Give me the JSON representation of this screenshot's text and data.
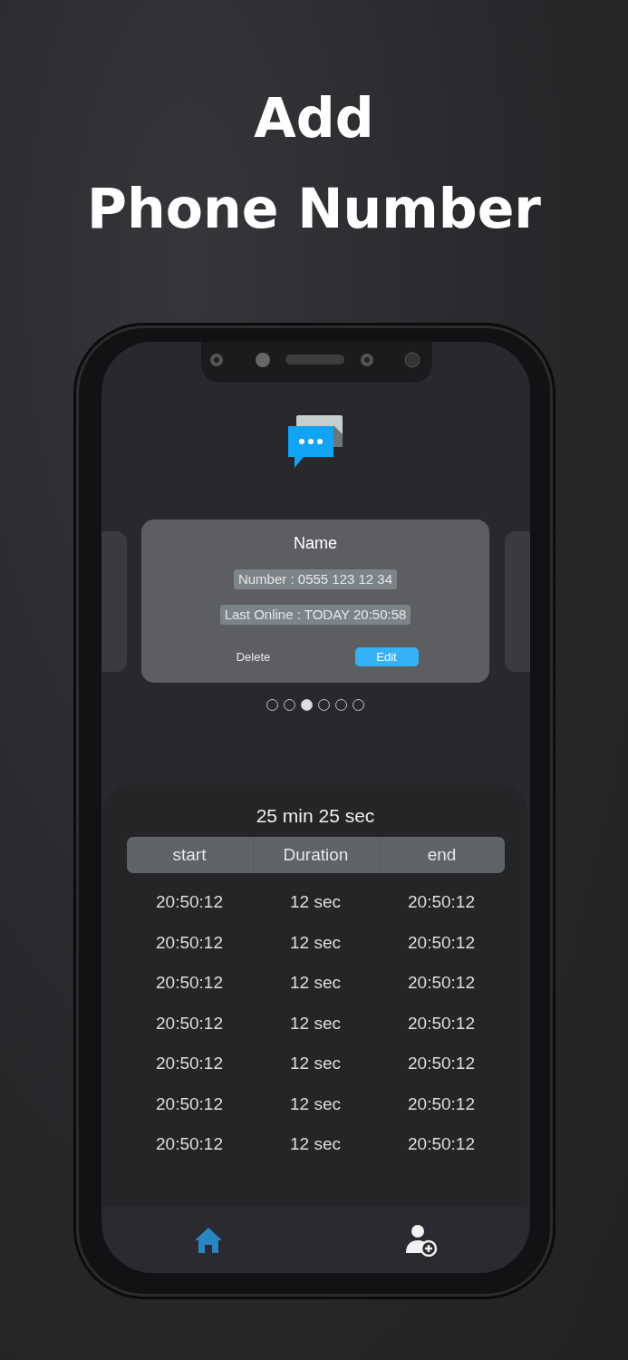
{
  "headline": [
    "Add",
    "Phone Number"
  ],
  "contact_card": {
    "name": "Name",
    "number": "Number : 0555 123 12 34",
    "last_online": "Last Online : TODAY 20:50:58",
    "buttons": [
      {
        "label": "Delete",
        "kind": "plain"
      },
      {
        "label": "Edit",
        "kind": "primary"
      }
    ]
  },
  "pager": [
    {
      "selected": false
    },
    {
      "selected": false
    },
    {
      "selected": true
    },
    {
      "selected": false
    },
    {
      "selected": false
    },
    {
      "selected": false
    }
  ],
  "calls": {
    "total": "25 min 25 sec",
    "columns": [
      "start",
      "Duration",
      "end"
    ],
    "rows": [
      [
        "20:50:12",
        "12 sec",
        "20:50:12"
      ],
      [
        "20:50:12",
        "12 sec",
        "20:50:12"
      ],
      [
        "20:50:12",
        "12 sec",
        "20:50:12"
      ],
      [
        "20:50:12",
        "12 sec",
        "20:50:12"
      ],
      [
        "20:50:12",
        "12 sec",
        "20:50:12"
      ],
      [
        "20:50:12",
        "12 sec",
        "20:50:12"
      ],
      [
        "20:50:12",
        "12 sec",
        "20:50:12"
      ]
    ]
  },
  "nav": [
    {
      "kind": "home",
      "selected": true
    },
    {
      "kind": "add-person",
      "selected": false
    }
  ]
}
